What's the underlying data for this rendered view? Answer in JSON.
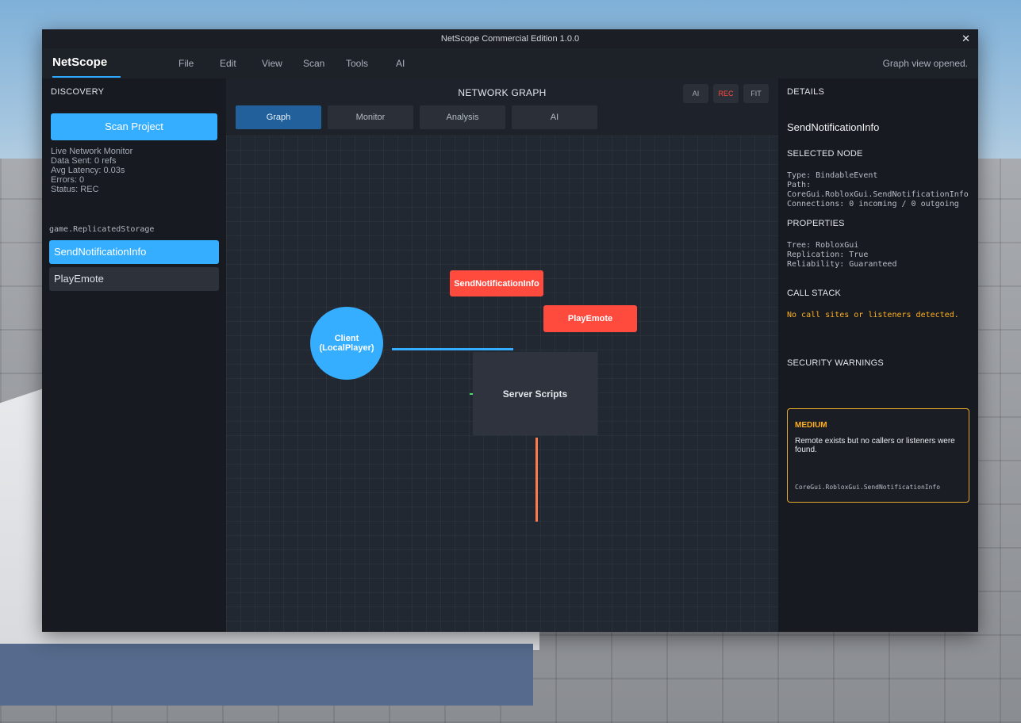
{
  "window": {
    "title": "NetScope Commercial Edition 1.0.0",
    "close_label": "✕"
  },
  "menubar": {
    "brand": "NetScope",
    "items": [
      "File",
      "Edit",
      "View",
      "Scan",
      "Tools",
      "AI"
    ],
    "status": "Graph view opened."
  },
  "discovery": {
    "header": "DISCOVERY",
    "scan_button": "Scan Project",
    "stats": [
      "Live Network Monitor",
      "Data Sent: 0 refs",
      "Avg Latency: 0.03s",
      "Errors: 0",
      "Status: REC"
    ],
    "tree_label": "game.ReplicatedStorage",
    "items": [
      {
        "label": "SendNotificationInfo",
        "selected": true
      },
      {
        "label": "PlayEmote",
        "selected": false
      }
    ]
  },
  "graph": {
    "title": "NETWORK GRAPH",
    "buttons": {
      "ai": "AI",
      "rec": "REC",
      "fit": "FIT"
    },
    "tabs": [
      "Graph",
      "Monitor",
      "Analysis",
      "AI"
    ],
    "active_tab": "Graph",
    "nodes": {
      "client_line1": "Client",
      "client_line2": "(LocalPlayer)",
      "send_notification": "SendNotificationInfo",
      "play_emote": "PlayEmote",
      "server": "Server Scripts"
    },
    "colors": {
      "client": "#35aeff",
      "remote": "#ff4a3e",
      "server": "#2e333d",
      "edge_client": "#35aeff",
      "edge_server": "#ff7a4d",
      "edge_small": "#4cd964"
    }
  },
  "details": {
    "header": "DETAILS",
    "title": "SendNotificationInfo",
    "selected_node": {
      "header": "SELECTED NODE",
      "type": "Type: BindableEvent",
      "path_label": "Path:",
      "path": "CoreGui.RobloxGui.SendNotificationInfo",
      "connections": "Connections: 0 incoming / 0 outgoing"
    },
    "properties": {
      "header": "PROPERTIES",
      "tree": "Tree: RobloxGui",
      "replication": "Replication: True",
      "reliability": "Reliability: Guaranteed"
    },
    "call_stack": {
      "header": "CALL STACK",
      "message": "No call sites or listeners detected."
    },
    "security": {
      "header": "SECURITY WARNINGS",
      "level": "MEDIUM",
      "message": "Remote exists but no callers or listeners were found.",
      "path": "CoreGui.RobloxGui.SendNotificationInfo"
    }
  }
}
